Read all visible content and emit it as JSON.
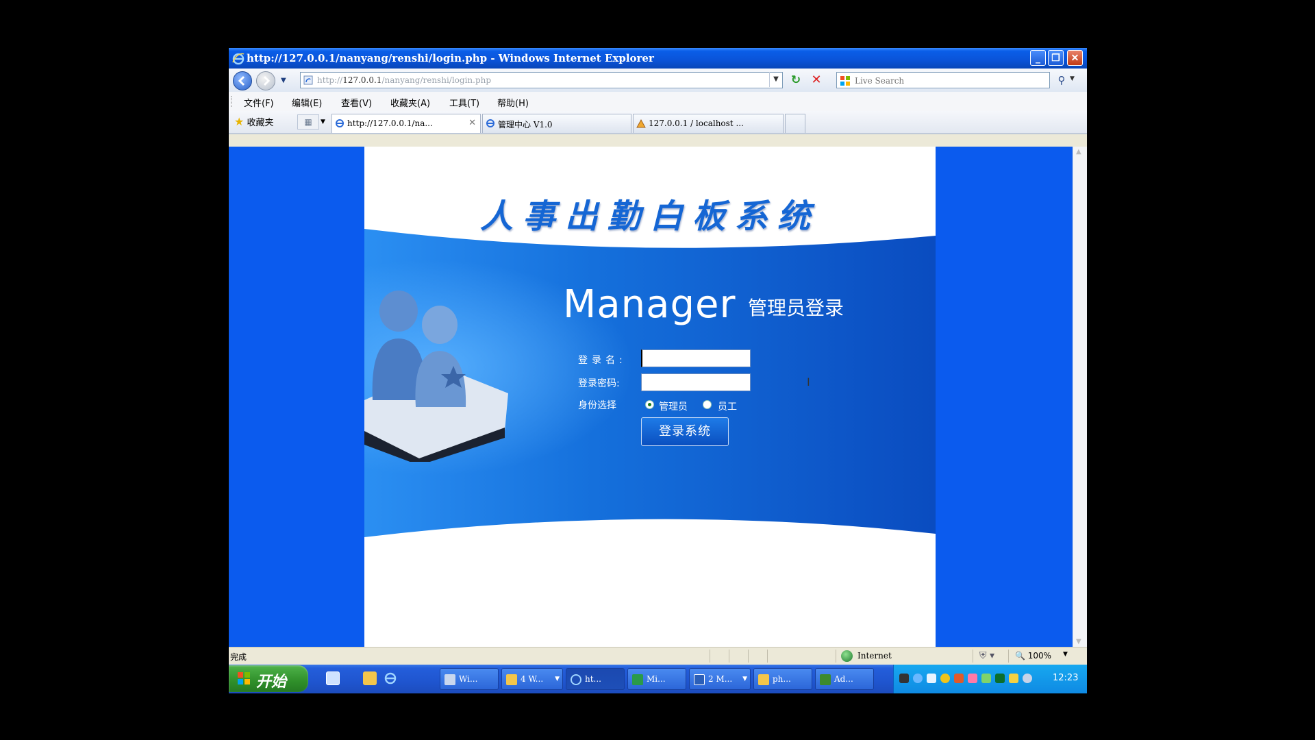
{
  "window": {
    "title": "http://127.0.0.1/nanyang/renshi/login.php - Windows Internet Explorer",
    "buttons": {
      "minimize": "_",
      "maximize": "❐",
      "close": "✕"
    }
  },
  "address_bar": {
    "url_prefix": "http://",
    "url_host": "127.0.0.1",
    "url_path": "/nanyang/renshi/login.php",
    "refresh_icon": "↻",
    "stop_icon": "✕"
  },
  "search": {
    "placeholder": "Live Search",
    "go_icon": "⚲"
  },
  "menu": [
    "文件(F)",
    "编辑(E)",
    "查看(V)",
    "收藏夹(A)",
    "工具(T)",
    "帮助(H)"
  ],
  "favorites_label": "收藏夹",
  "tabs": [
    {
      "label": "http://127.0.0.1/na...",
      "close": "✕",
      "active": true
    },
    {
      "label": "管理中心 V1.0",
      "active": false
    },
    {
      "label": "127.0.0.1 / localhost ...",
      "active": false
    }
  ],
  "page": {
    "system_title": "人事出勤白板系统",
    "manager_en": "Manager",
    "manager_cn": "管理员登录",
    "username_label": "登录名:",
    "password_label": "登录密码:",
    "role_label": "身份选择",
    "role_options": [
      "管理员",
      "员工"
    ],
    "role_selected": "管理员",
    "username_value": "",
    "password_value": "",
    "login_button": "登录系统"
  },
  "colors": {
    "page_background": "#0b5bee",
    "panel_blue": "#1466d6",
    "title_blue": "#1566d4"
  },
  "status_bar": {
    "text": "完成",
    "zone": "Internet",
    "zoom": "100%"
  },
  "taskbar": {
    "start_label": "开始",
    "tasks": [
      {
        "label": "Wi...",
        "icon": "computer-icon"
      },
      {
        "label": "4 W...",
        "icon": "folder-icon"
      },
      {
        "label": "ht...",
        "icon": "ie-icon"
      },
      {
        "label": "Mi...",
        "icon": "app-icon"
      },
      {
        "label": "2 M...",
        "icon": "word-icon"
      },
      {
        "label": "ph...",
        "icon": "folder-icon"
      },
      {
        "label": "Ad...",
        "icon": "dreamweaver-icon"
      }
    ],
    "clock": "12:23"
  }
}
